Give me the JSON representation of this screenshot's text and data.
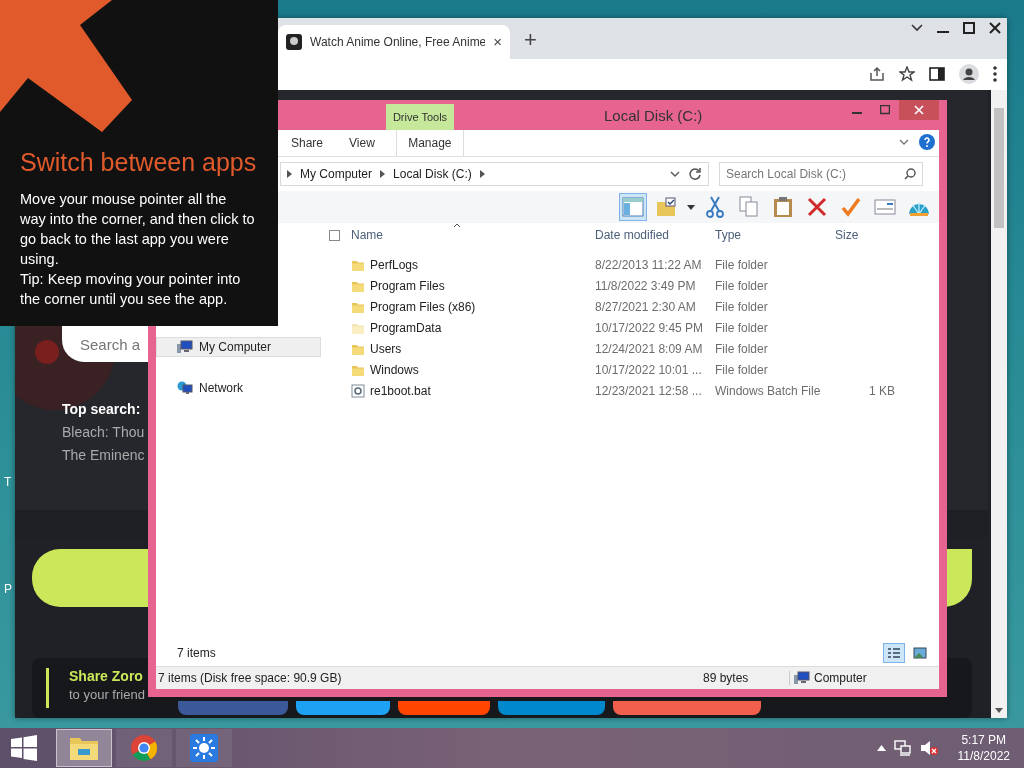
{
  "desktop": {
    "icon_labels": [
      "T",
      "P"
    ]
  },
  "browser": {
    "tab": {
      "title": "Watch Anime Online, Free Anime",
      "close": "×"
    },
    "new_tab": "+",
    "page": {
      "search": {
        "placeholder": "Search a"
      },
      "top_search": {
        "label": "Top search:",
        "items": [
          "Bleach: Thou",
          "The Eminenc"
        ]
      },
      "share": {
        "title": "Share Zoro",
        "subtitle": "to your friend"
      }
    }
  },
  "explorer": {
    "title": "Local Disk (C:)",
    "ribbon": {
      "context_group": "Drive Tools",
      "tabs": [
        {
          "label": "Share",
          "selected": false
        },
        {
          "label": "View",
          "selected": false
        },
        {
          "label": "Manage",
          "selected": false
        }
      ]
    },
    "address": [
      "My Computer",
      "Local Disk (C:)"
    ],
    "search": {
      "placeholder": "Search Local Disk (C:)"
    },
    "nav": [
      {
        "label": "My Computer",
        "selected": true
      },
      {
        "label": "Network",
        "selected": false
      }
    ],
    "select_all": {
      "checked": false
    },
    "columns": [
      "Name",
      "Date modified",
      "Type",
      "Size"
    ],
    "rows": [
      {
        "kind": "folder",
        "name": "PerfLogs",
        "date": "8/22/2013 11:22 AM",
        "type": "File folder",
        "hidden": false
      },
      {
        "kind": "folder",
        "name": "Program Files",
        "date": "11/8/2022 3:49 PM",
        "type": "File folder",
        "hidden": false
      },
      {
        "kind": "folder",
        "name": "Program Files (x86)",
        "date": "8/27/2021 2:30 AM",
        "type": "File folder",
        "hidden": false
      },
      {
        "kind": "folder",
        "name": "ProgramData",
        "date": "10/17/2022 9:45 PM",
        "type": "File folder",
        "hidden": true
      },
      {
        "kind": "folder",
        "name": "Users",
        "date": "12/24/2021 8:09 AM",
        "type": "File folder",
        "hidden": false
      },
      {
        "kind": "folder",
        "name": "Windows",
        "date": "10/17/2022 10:01 ...",
        "type": "File folder",
        "hidden": false
      },
      {
        "kind": "batch",
        "name": "re1boot.bat",
        "date": "12/23/2021 12:58 ...",
        "type": "Windows Batch File",
        "size": "1 KB",
        "hidden": false
      }
    ],
    "item_count": "7 items",
    "status": {
      "items": "7 items (Disk free space: 90.9 GB)",
      "size": "89 bytes",
      "location": "Computer"
    }
  },
  "hint": {
    "title": "Switch between apps",
    "body": "Move your mouse pointer all the way into the corner, and then click to go back to the last app you were using.",
    "tip": "Tip: Keep moving your pointer into the corner until you see the app."
  },
  "taskbar": {
    "apps": [
      {
        "kind": "explorer",
        "selected": true
      },
      {
        "kind": "chrome",
        "selected": false
      },
      {
        "kind": "sun",
        "selected": false
      }
    ],
    "muted": true,
    "time": "5:17 PM",
    "date": "11/8/2022"
  }
}
